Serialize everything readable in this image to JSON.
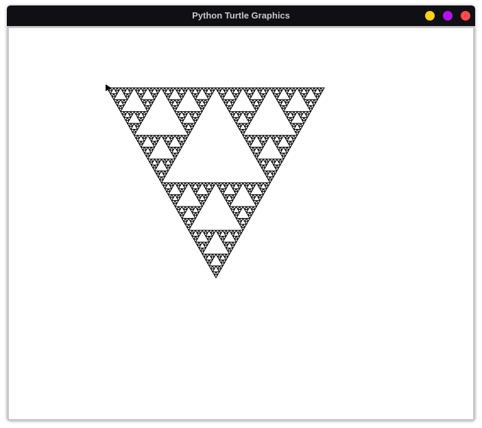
{
  "window": {
    "title": "Python Turtle Graphics",
    "buttons": [
      {
        "name": "minimize",
        "color": "#ffd20a"
      },
      {
        "name": "maximize",
        "color": "#b410f5"
      },
      {
        "name": "close",
        "color": "#ff4a4a"
      }
    ]
  },
  "canvas": {
    "background": "#ffffff",
    "drawing": {
      "shape": "sierpinski-triangle",
      "orientation": "inverted",
      "recursion_depth": 6,
      "line_color": "#000000",
      "turtle_icon": "turtle-arrow-icon"
    }
  }
}
